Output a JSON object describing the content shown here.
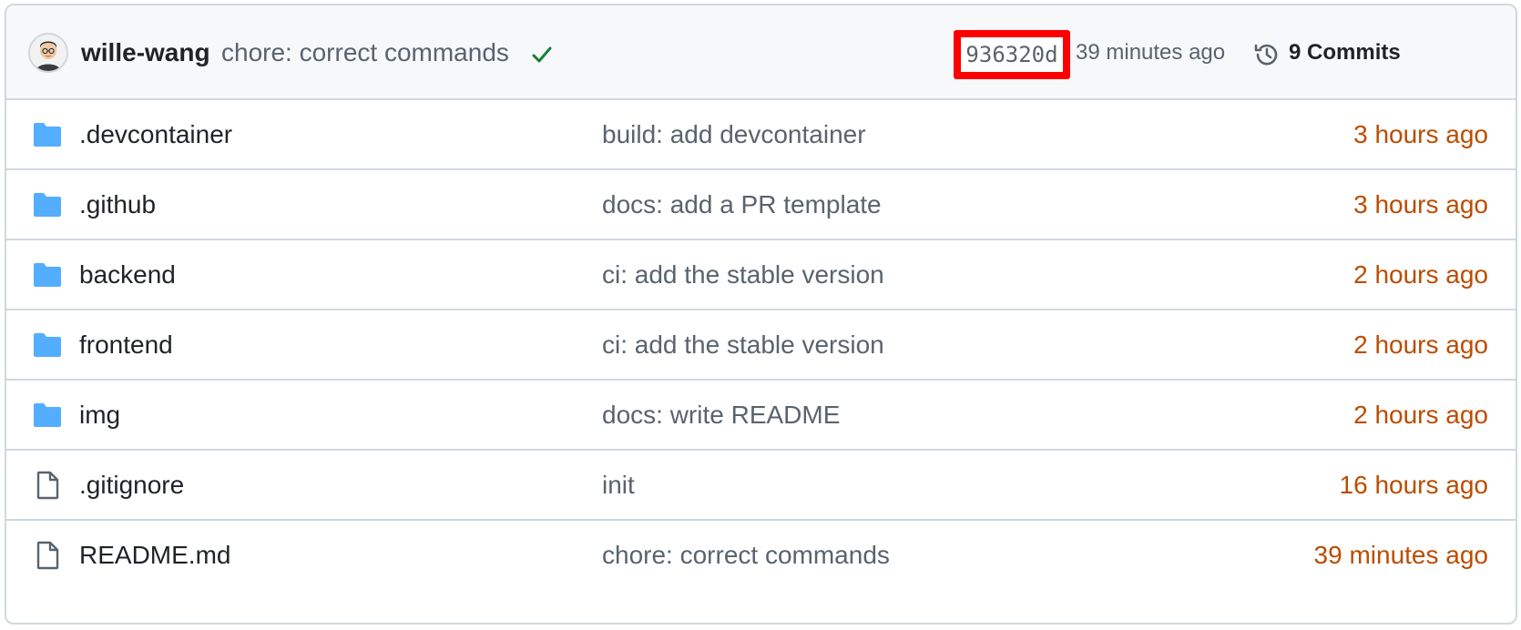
{
  "header": {
    "author": "wille-wang",
    "commit_message": "chore: correct commands",
    "sha": "936320d",
    "time_ago": "39 minutes ago",
    "commits_label": "9 Commits"
  },
  "files": [
    {
      "name": ".devcontainer",
      "type": "folder",
      "message": "build: add devcontainer",
      "time": "3 hours ago"
    },
    {
      "name": ".github",
      "type": "folder",
      "message": "docs: add a PR template",
      "time": "3 hours ago"
    },
    {
      "name": "backend",
      "type": "folder",
      "message": "ci: add the stable version",
      "time": "2 hours ago"
    },
    {
      "name": "frontend",
      "type": "folder",
      "message": "ci: add the stable version",
      "time": "2 hours ago"
    },
    {
      "name": "img",
      "type": "folder",
      "message": "docs: write README",
      "time": "2 hours ago"
    },
    {
      "name": ".gitignore",
      "type": "file",
      "message": "init",
      "time": "16 hours ago"
    },
    {
      "name": "README.md",
      "type": "file",
      "message": "chore: correct commands",
      "time": "39 minutes ago"
    }
  ],
  "colors": {
    "folder": "#54aeff",
    "time": "#bc4c00",
    "check": "#1a7f37",
    "highlight": "#ff0000"
  }
}
